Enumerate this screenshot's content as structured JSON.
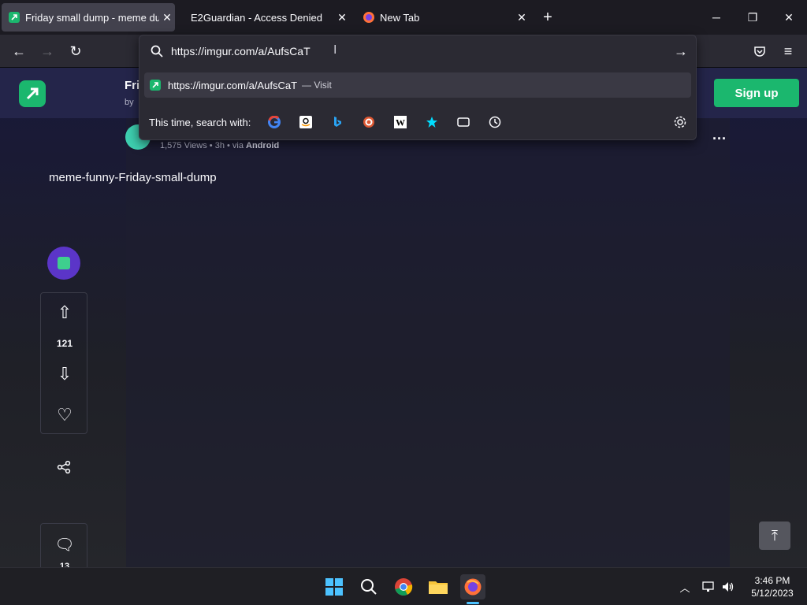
{
  "tabs": [
    {
      "title": "Friday small dump - meme dump",
      "active": true,
      "favicon": "imgur-icon"
    },
    {
      "title": "E2Guardian - Access Denied",
      "active": false,
      "favicon": ""
    },
    {
      "title": "New Tab",
      "active": false,
      "favicon": "firefox-icon"
    }
  ],
  "window_controls": {
    "minimize": "─",
    "restore": "❐",
    "close": "✕"
  },
  "urlbar": {
    "value": "https://imgur.com/a/AufsCaT",
    "result_url": "https://imgur.com/a/AufsCaT",
    "result_action": "— Visit",
    "search_with_label": "This time, search with:"
  },
  "search_engines": [
    "google-icon",
    "amazon-icon",
    "bing-icon",
    "duckduckgo-icon",
    "wikipedia-icon",
    "bookmarks-icon",
    "tabs-icon",
    "history-icon"
  ],
  "imgur": {
    "signup_label": "Sign up",
    "post_title_partial": "Fri",
    "by_partial": "by",
    "meta_views": "1,575 Views",
    "meta_time": "3h",
    "meta_via": "via",
    "meta_source": "Android",
    "post_description": "meme-funny-Friday-small-dump",
    "vote_count": "121",
    "comment_count": "13"
  },
  "taskbar": {
    "time": "3:46 PM",
    "date": "5/12/2023"
  },
  "colors": {
    "accent": "#1bb76e",
    "tab_active": "#42414d",
    "panel": "#2b2a33"
  }
}
